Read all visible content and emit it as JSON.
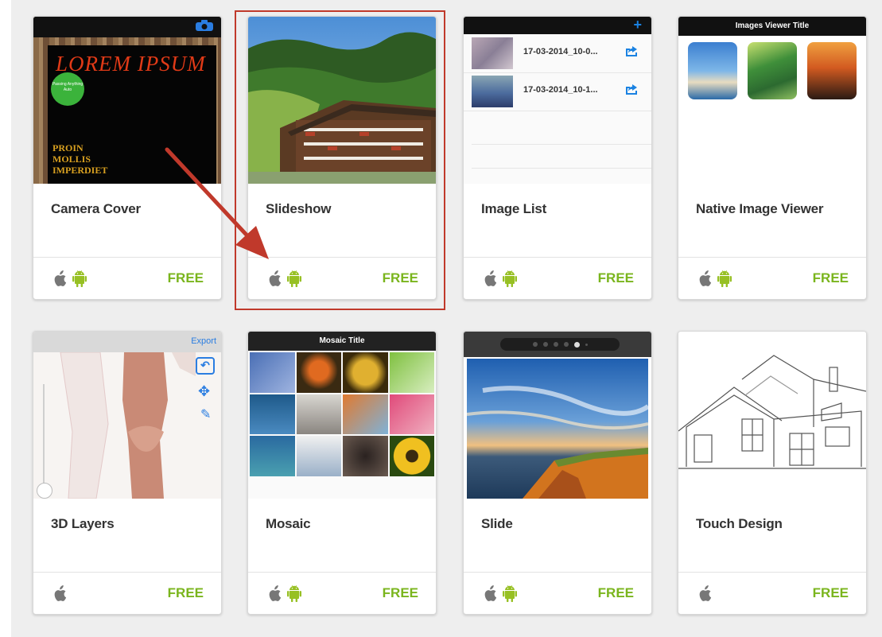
{
  "cards": [
    {
      "title": "Camera Cover",
      "price": "FREE",
      "platforms": [
        "apple-icon",
        "android-icon"
      ],
      "thumb": {
        "heading": "LOREM IPSUM",
        "badge": "Passing Anything Auto",
        "body_lines": [
          "PROIN",
          "MOLLIS",
          "IMPERDIET"
        ]
      }
    },
    {
      "title": "Slideshow",
      "price": "FREE",
      "platforms": [
        "apple-icon",
        "android-icon"
      ],
      "selected": true
    },
    {
      "title": "Image List",
      "price": "FREE",
      "platforms": [
        "apple-icon",
        "android-icon"
      ],
      "thumb": {
        "items": [
          "17-03-2014_10-0...",
          "17-03-2014_10-1..."
        ]
      }
    },
    {
      "title": "Native Image Viewer",
      "price": "FREE",
      "platforms": [
        "apple-icon",
        "android-icon"
      ],
      "thumb": {
        "header": "Images Viewer Title"
      }
    },
    {
      "title": "3D Layers",
      "price": "FREE",
      "platforms": [
        "apple-icon"
      ],
      "thumb": {
        "export_label": "Export"
      }
    },
    {
      "title": "Mosaic",
      "price": "FREE",
      "platforms": [
        "apple-icon",
        "android-icon"
      ],
      "thumb": {
        "header": "Mosaic Title"
      }
    },
    {
      "title": "Slide",
      "price": "FREE",
      "platforms": [
        "apple-icon",
        "android-icon"
      ]
    },
    {
      "title": "Touch Design",
      "price": "FREE",
      "platforms": [
        "apple-icon"
      ]
    }
  ],
  "colors": {
    "price_green": "#7ab51d",
    "highlight_red": "#c0392b",
    "android_green": "#97c024",
    "apple_gray": "#777777",
    "ios_blue": "#1a82e2"
  }
}
